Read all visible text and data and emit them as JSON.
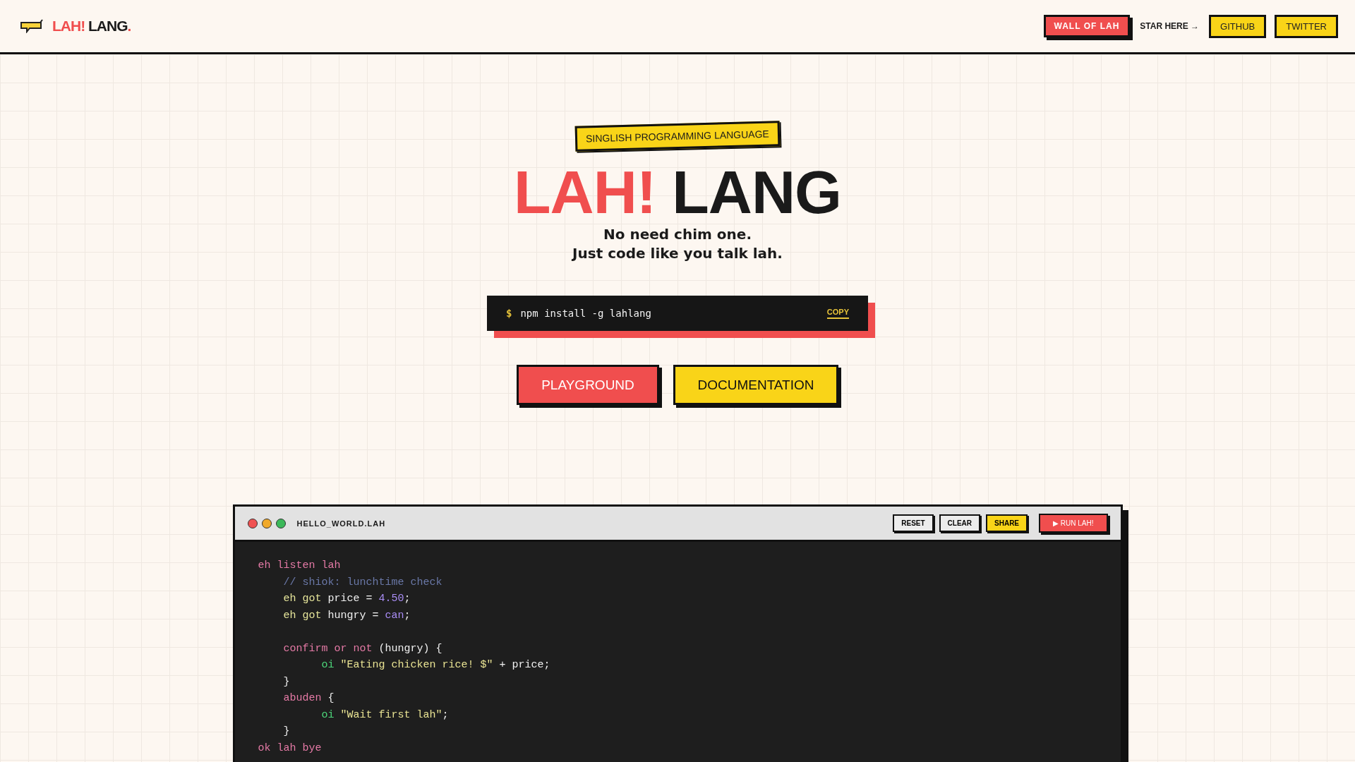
{
  "header": {
    "brand": {
      "accent": "LAH!",
      "main": "LANG",
      "dot": "."
    },
    "nav": [
      {
        "label": "WALL OF LAH",
        "kind": "primary"
      },
      {
        "label": "STAR HERE →",
        "kind": "text"
      },
      {
        "label": "GITHUB",
        "kind": "secondary"
      },
      {
        "label": "TWITTER",
        "kind": "secondary"
      }
    ]
  },
  "hero": {
    "badge": "SINGLISH PROGRAMMING LANGUAGE",
    "title_accent": "LAH!",
    "title_main": "LANG",
    "tagline": [
      "No need chim one.",
      "Just code like you talk lah."
    ],
    "install": {
      "prompt": "$",
      "command": "npm install -g lahlang",
      "copy": "COPY"
    },
    "buttons": [
      {
        "label": "PLAYGROUND",
        "kind": "primary"
      },
      {
        "label": "DOCUMENTATION",
        "kind": "secondary"
      }
    ]
  },
  "editor": {
    "filename": "HELLO_WORLD.LAH",
    "buttons": [
      {
        "label": "RESET",
        "kind": "plain"
      },
      {
        "label": "CLEAR",
        "kind": "plain"
      },
      {
        "label": "SHARE",
        "kind": "secondary"
      },
      {
        "label": "▶ RUN LAH!",
        "kind": "primary"
      }
    ],
    "lines": [
      [
        {
          "text": "eh listen lah",
          "kind": "keyword"
        }
      ],
      [
        {
          "text": "    // shiok: lunchtime check",
          "kind": "comment"
        }
      ],
      [
        {
          "text": "    eh got",
          "kind": "declare"
        },
        {
          "text": " price = ",
          "kind": "plain"
        },
        {
          "text": "4.50",
          "kind": "value"
        },
        {
          "text": ";",
          "kind": "plain"
        }
      ],
      [
        {
          "text": "    eh got",
          "kind": "declare"
        },
        {
          "text": " hungry = ",
          "kind": "plain"
        },
        {
          "text": "can",
          "kind": "value"
        },
        {
          "text": ";",
          "kind": "plain"
        }
      ],
      {
        "kind": "blank"
      },
      [
        {
          "text": "    confirm or not",
          "kind": "keyword"
        },
        {
          "text": " (hungry) {",
          "kind": "plain"
        }
      ],
      [
        {
          "text": "          oi",
          "kind": "print"
        },
        {
          "text": " \"Eating chicken rice! $\"",
          "kind": "string"
        },
        {
          "text": " + price;",
          "kind": "plain"
        }
      ],
      [
        {
          "text": "    }",
          "kind": "plain"
        }
      ],
      [
        {
          "text": "    abuden",
          "kind": "keyword"
        },
        {
          "text": " {",
          "kind": "plain"
        }
      ],
      [
        {
          "text": "          oi",
          "kind": "print"
        },
        {
          "text": " \"Wait first lah\"",
          "kind": "string"
        },
        {
          "text": ";",
          "kind": "plain"
        }
      ],
      [
        {
          "text": "    }",
          "kind": "plain"
        }
      ],
      [
        {
          "text": "ok lah bye",
          "kind": "keyword"
        }
      ]
    ]
  }
}
